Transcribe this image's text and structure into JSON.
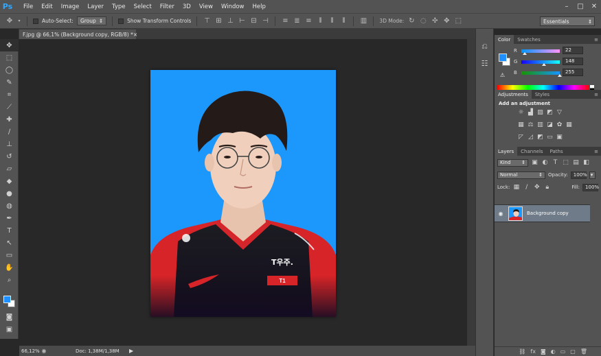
{
  "app": {
    "logo": "Ps"
  },
  "menu": [
    "File",
    "Edit",
    "Image",
    "Layer",
    "Type",
    "Select",
    "Filter",
    "3D",
    "View",
    "Window",
    "Help"
  ],
  "window_controls": [
    "–",
    "□",
    "✕"
  ],
  "options": {
    "auto_select_label": "Auto-Select:",
    "auto_select_value": "Group",
    "transform_label": "Show Transform Controls",
    "mode_3d_label": "3D Mode:",
    "workspace": "Essentials"
  },
  "document": {
    "tab_title": "F.jpg @ 66,1% (Background copy, RGB/8) *",
    "tab_close": "×",
    "zoom": "66,12%",
    "doc_info": "Doc: 1,38M/1,38M",
    "photo_jersey_text": "T우주."
  },
  "tools": [
    "move-icon",
    "marquee-icon",
    "lasso-icon",
    "quick-select-icon",
    "crop-icon",
    "eyedropper-icon",
    "healing-icon",
    "brush-icon",
    "stamp-icon",
    "history-brush-icon",
    "eraser-icon",
    "bucket-icon",
    "blur-icon",
    "dodge-icon",
    "pen-icon",
    "type-icon",
    "path-select-icon",
    "shape-icon",
    "hand-icon",
    "zoom-icon"
  ],
  "color_panel": {
    "tabs": [
      "Color",
      "Swatches"
    ],
    "r_label": "R",
    "g_label": "G",
    "b_label": "B",
    "r": 22,
    "g": 148,
    "b": 255,
    "foreground": "#1694ff",
    "background": "#ffffff"
  },
  "adjustments_panel": {
    "tabs": [
      "Adjustments",
      "Styles"
    ],
    "title": "Add an adjustment"
  },
  "layers_panel": {
    "tabs": [
      "Layers",
      "Channels",
      "Paths"
    ],
    "kind": "Kind",
    "blend_mode": "Normal",
    "opacity_label": "Opacity:",
    "opacity": "100%",
    "lock_label": "Lock:",
    "fill_label": "Fill:",
    "fill": "100%",
    "layers": [
      {
        "name": "Background copy",
        "visible": true
      }
    ]
  },
  "colors": {
    "photo_bg": "#1c97fb",
    "panel": "#535353",
    "selected_layer": "#6f7b88"
  }
}
